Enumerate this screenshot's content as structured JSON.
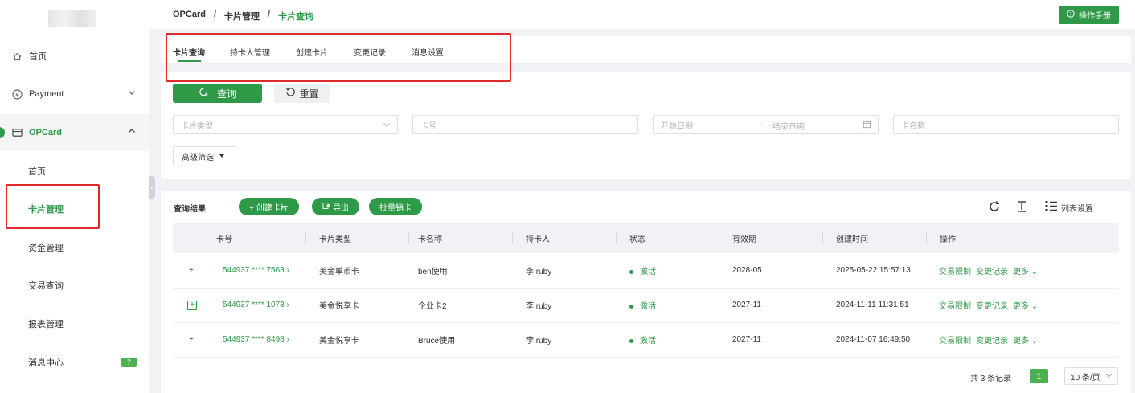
{
  "breadcrumb": {
    "root": "OPCard",
    "sep1": "/",
    "mid": "卡片管理",
    "sep2": "/",
    "current": "卡片查询"
  },
  "header": {
    "manual_button": "操作手册"
  },
  "sidebar": {
    "home": "首页",
    "payment": "Payment",
    "opcard": "OPCard",
    "sub_items": [
      "首页",
      "卡片管理",
      "资金管理",
      "交易查询",
      "报表管理",
      "消息中心"
    ],
    "message_badge": "7"
  },
  "tabs": [
    "卡片查询",
    "持卡人管理",
    "创建卡片",
    "变更记录",
    "消息设置"
  ],
  "filters": {
    "query_button": "查询",
    "reset_button": "重置",
    "card_type_placeholder": "卡片类型",
    "card_no_placeholder": "卡号",
    "start_date_placeholder": "开始日期",
    "date_arrow": "→",
    "end_date_placeholder": "结束日期",
    "card_name_placeholder": "卡名称",
    "advanced_button": "高级筛选"
  },
  "results": {
    "label": "查询结果",
    "create_button": "+ 创建卡片",
    "export_button": "导出",
    "batch_cancel_button": "批量销卡",
    "column_settings": "列表设置"
  },
  "table": {
    "headers": [
      "卡号",
      "卡片类型",
      "卡名称",
      "持卡人",
      "状态",
      "有效期",
      "创建时间",
      "操作"
    ],
    "rows": [
      {
        "expand": "+",
        "card_no": "544937 **** 7563",
        "type": "美金单币卡",
        "name": "ben使用",
        "holder": "李 ruby",
        "status": "激活",
        "expiry": "2028-05",
        "created": "2025-05-22 15:57:13",
        "op1": "交易限制",
        "op2": "变更记录",
        "op3": "更多"
      },
      {
        "expand": "+",
        "card_no": "544937 **** 1073",
        "type": "美金悦享卡",
        "name": "企业卡2",
        "holder": "李 ruby",
        "status": "激活",
        "expiry": "2027-11",
        "created": "2024-11-11 11:31:51",
        "op1": "交易限制",
        "op2": "变更记录",
        "op3": "更多"
      },
      {
        "expand": "+",
        "card_no": "544937 **** 8498",
        "type": "美金悦享卡",
        "name": "Bruce使用",
        "holder": "李 ruby",
        "status": "激活",
        "expiry": "2027-11",
        "created": "2024-11-07 16:49:50",
        "op1": "交易限制",
        "op2": "变更记录",
        "op3": "更多"
      }
    ]
  },
  "pagination": {
    "total": "共 3 条记录",
    "page": "1",
    "page_size": "10 条/页"
  },
  "colors": {
    "accent": "#2e9a47",
    "annotation_red": "#e02b2b"
  }
}
